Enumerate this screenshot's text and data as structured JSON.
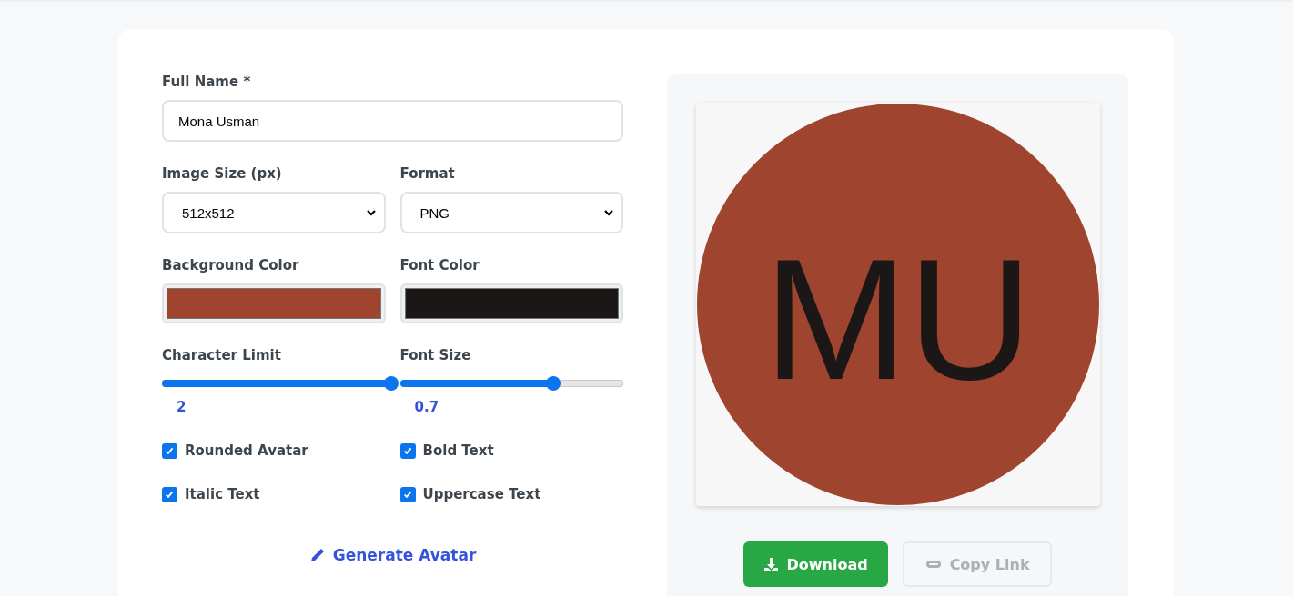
{
  "form": {
    "full_name": {
      "label": "Full Name *",
      "value": "Mona Usman"
    },
    "image_size": {
      "label": "Image Size (px)",
      "value": "512x512"
    },
    "format": {
      "label": "Format",
      "value": "PNG"
    },
    "background_color": {
      "label": "Background Color",
      "color": "#9e442f"
    },
    "font_color": {
      "label": "Font Color",
      "color": "#1c1717"
    },
    "sliders": [
      {
        "label": "Character Limit",
        "level": 1,
        "reading": "2"
      },
      {
        "label": "Font Size",
        "level": 0.66,
        "reading": "0.7"
      }
    ],
    "options": [
      {
        "label": "Rounded Avatar",
        "checked": true
      },
      {
        "label": "Bold Text",
        "checked": true
      },
      {
        "label": "Italic Text",
        "checked": true
      },
      {
        "label": "Uppercase Text",
        "checked": true
      }
    ],
    "generate_button": "Generate Avatar"
  },
  "preview": {
    "initials": "MU",
    "buttons": [
      {
        "label": "Download",
        "kind": "primary"
      },
      {
        "label": "Copy Link",
        "kind": "outline"
      }
    ]
  }
}
